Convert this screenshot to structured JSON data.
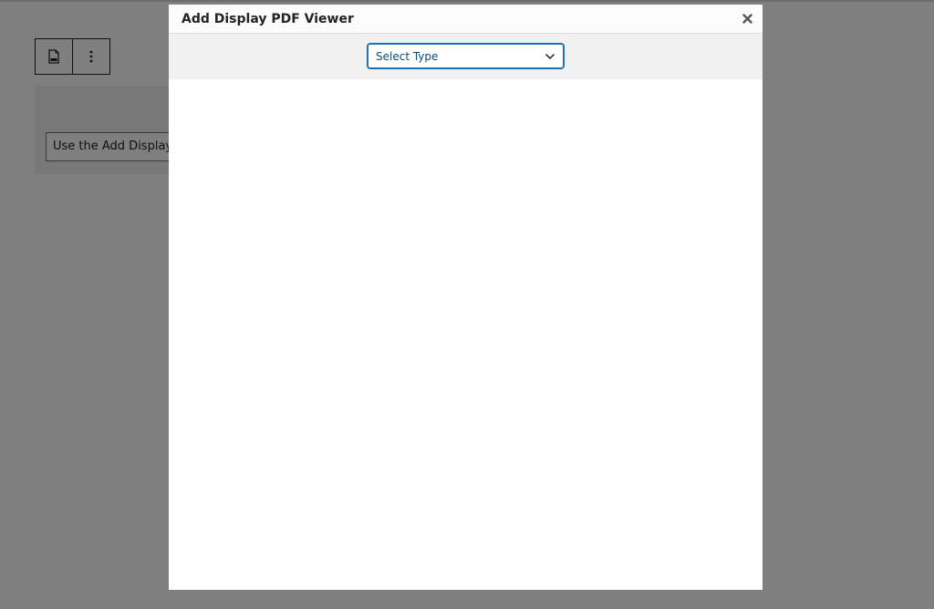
{
  "editor": {
    "block_input_text": "Use the Add Display PDF Viewer button"
  },
  "modal": {
    "title": "Add Display PDF Viewer",
    "select": {
      "selected": "Select Type"
    }
  },
  "icons": {
    "toolbar_block": "pdf-file-icon",
    "toolbar_more": "more-vertical-icon",
    "close": "close-icon",
    "chevron": "chevron-down-icon"
  },
  "colors": {
    "overlay": "#000000",
    "accent": "#2271b1",
    "select_text": "#0a4b78"
  }
}
